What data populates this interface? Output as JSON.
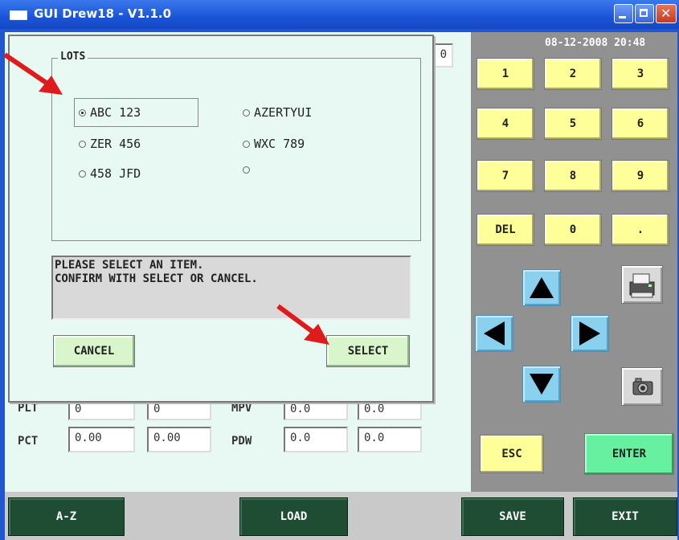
{
  "window": {
    "title": "GUI Drew18 - V1.1.0"
  },
  "datetime": "08-12-2008 20:48",
  "hidden_field_value": "0",
  "keypad": [
    "1",
    "2",
    "3",
    "4",
    "5",
    "6",
    "7",
    "8",
    "9",
    "DEL",
    "0",
    "."
  ],
  "buttons": {
    "esc": "ESC",
    "enter": "ENTER"
  },
  "bottom_bar": {
    "az": "A-Z",
    "load": "LOAD",
    "save": "SAVE",
    "exit": "EXIT"
  },
  "fields": [
    {
      "label": "PLT",
      "v1": "0",
      "v2": "0"
    },
    {
      "label": "MPV",
      "v1": "0.0",
      "v2": "0.0"
    },
    {
      "label": "PCT",
      "v1": "0.00",
      "v2": "0.00"
    },
    {
      "label": "PDW",
      "v1": "0.0",
      "v2": "0.0"
    }
  ],
  "dialog": {
    "group_label": "LOTS",
    "options": [
      "ABC 123",
      "AZERTYUI",
      "ZER 456",
      "WXC 789",
      "458 JFD",
      ""
    ],
    "selected_option": "ABC 123",
    "message": "PLEASE SELECT AN ITEM.\nCONFIRM WITH SELECT OR CANCEL.",
    "cancel_label": "CANCEL",
    "select_label": "SELECT"
  },
  "colors": {
    "titlebar": "#1a55d8",
    "panel": "#e8f8f2",
    "keypad": "#ffff99",
    "arrow_buttons": "#8ad0ef",
    "green_buttons": "#d8f5cc",
    "bottom_buttons": "#1e4d33",
    "annotation_arrow": "#e01b1b"
  },
  "icons": [
    "printer-icon",
    "camera-icon",
    "arrow-up-icon",
    "arrow-down-icon",
    "arrow-left-icon",
    "arrow-right-icon"
  ]
}
